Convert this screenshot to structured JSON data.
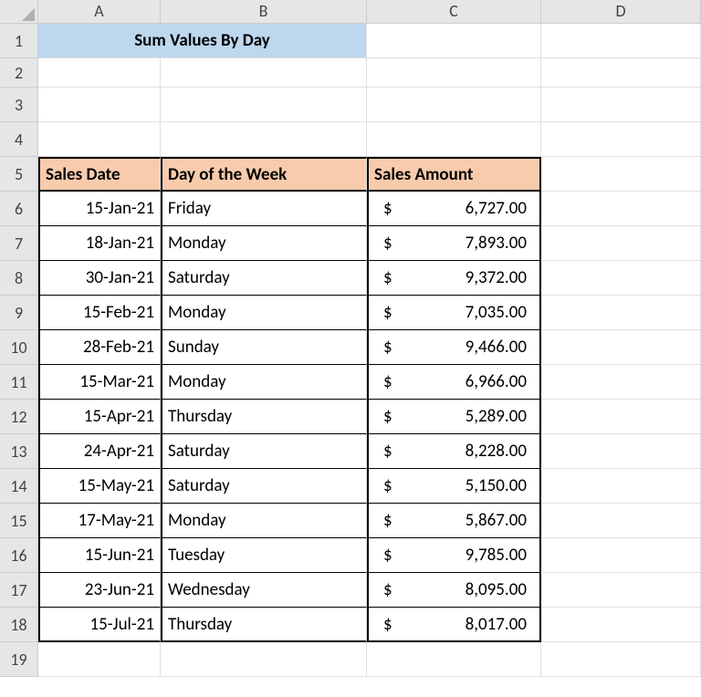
{
  "columns": [
    "A",
    "B",
    "C",
    "D"
  ],
  "rowNumbers": [
    1,
    2,
    3,
    4,
    5,
    6,
    7,
    8,
    9,
    10,
    11,
    12,
    13,
    14,
    15,
    16,
    17,
    18,
    19
  ],
  "title": "Sum Values By Day",
  "headers": {
    "date": "Sales Date",
    "day": "Day of the Week",
    "amount": "Sales Amount"
  },
  "currency": "$",
  "rows": [
    {
      "date": "15-Jan-21",
      "day": "Friday",
      "amount": "6,727.00"
    },
    {
      "date": "18-Jan-21",
      "day": "Monday",
      "amount": "7,893.00"
    },
    {
      "date": "30-Jan-21",
      "day": "Saturday",
      "amount": "9,372.00"
    },
    {
      "date": "15-Feb-21",
      "day": "Monday",
      "amount": "7,035.00"
    },
    {
      "date": "28-Feb-21",
      "day": "Sunday",
      "amount": "9,466.00"
    },
    {
      "date": "15-Mar-21",
      "day": "Monday",
      "amount": "6,966.00"
    },
    {
      "date": "15-Apr-21",
      "day": "Thursday",
      "amount": "5,289.00"
    },
    {
      "date": "24-Apr-21",
      "day": "Saturday",
      "amount": "8,228.00"
    },
    {
      "date": "15-May-21",
      "day": "Saturday",
      "amount": "5,150.00"
    },
    {
      "date": "17-May-21",
      "day": "Monday",
      "amount": "5,867.00"
    },
    {
      "date": "15-Jun-21",
      "day": "Tuesday",
      "amount": "9,785.00"
    },
    {
      "date": "23-Jun-21",
      "day": "Wednesday",
      "amount": "8,095.00"
    },
    {
      "date": "15-Jul-21",
      "day": "Thursday",
      "amount": "8,017.00"
    }
  ]
}
